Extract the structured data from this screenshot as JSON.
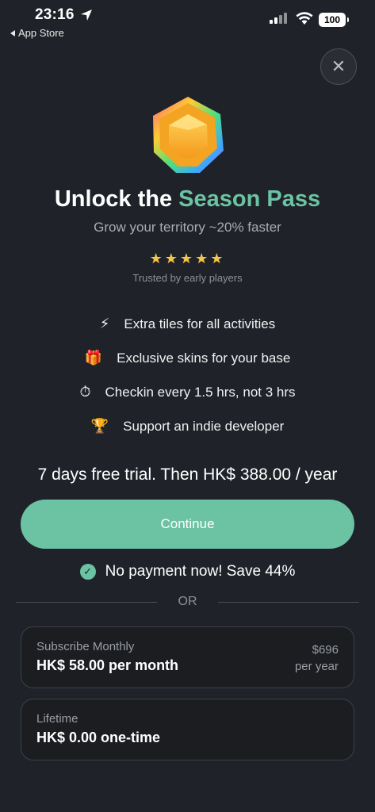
{
  "status_bar": {
    "time": "23:16",
    "back_label": "App Store",
    "battery": "100"
  },
  "header": {
    "close_label": "✕"
  },
  "hero": {
    "title_prefix": "Unlock the ",
    "title_accent": "Season Pass",
    "subtitle": "Grow your territory ~20% faster",
    "stars": "★★★★★",
    "rating_count": 5,
    "trusted_text": "Trusted by early players"
  },
  "features": [
    {
      "icon": "⚡",
      "icon_name": "lightning-icon",
      "label": "Extra tiles for all activities"
    },
    {
      "icon": "🎁",
      "icon_name": "gift-icon",
      "label": "Exclusive skins for your base"
    },
    {
      "icon": "⏱",
      "icon_name": "stopwatch-icon",
      "label": "Checkin every 1.5 hrs, not 3 hrs"
    },
    {
      "icon": "🏆",
      "icon_name": "trophy-icon",
      "label": "Support an indie developer"
    }
  ],
  "offer": {
    "trial_text": "7 days free trial. Then HK$ 388.00 / year",
    "continue_label": "Continue",
    "no_payment_text": "No payment now! Save 44%",
    "or_text": "OR"
  },
  "plans": [
    {
      "name": "Subscribe Monthly",
      "price": "HK$ 58.00 per month",
      "yearly_amount": "$696",
      "yearly_unit": "per year"
    },
    {
      "name": "Lifetime",
      "price": "HK$ 0.00 one-time"
    }
  ],
  "colors": {
    "background": "#1f2329",
    "accent": "#6cc3a4",
    "star": "#f4c54a"
  }
}
